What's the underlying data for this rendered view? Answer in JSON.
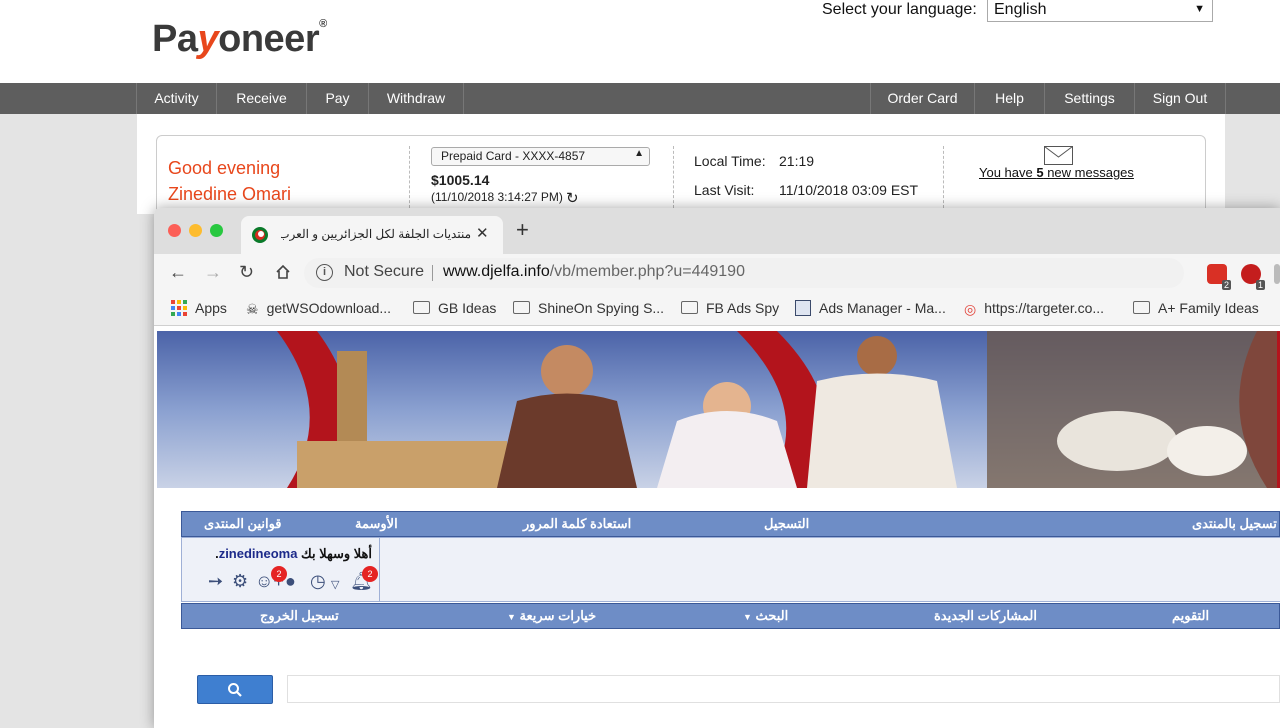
{
  "payoneer": {
    "logo_pre": "Pa",
    "logo_mid": "y",
    "logo_post": "oneer",
    "language_label": "Select your language:",
    "language_value": "English",
    "nav_left": [
      "Activity",
      "Receive",
      "Pay",
      "Withdraw"
    ],
    "nav_right": [
      "Order Card",
      "Help",
      "Settings",
      "Sign Out"
    ],
    "greeting": "Good evening",
    "user_name": "Zinedine Omari",
    "card_select": "Prepaid Card - XXXX-4857",
    "balance": "$1005.14",
    "balance_time": "(11/10/2018 3:14:27 PM)",
    "local_time_label": "Local Time:",
    "local_time_value": "21:19",
    "last_visit_label": "Last Visit:",
    "last_visit_value": "11/10/2018 03:09 EST",
    "messages_prefix": "You have ",
    "messages_count": "5",
    "messages_suffix": " new messages",
    "brand_color": "#e8471c"
  },
  "chrome": {
    "tab_title": "منتديات الجلفة لكل الجزائريين و العرب - ...",
    "not_secure": "Not Secure",
    "url_host": "www.djelfa.info",
    "url_path": "/vb/member.php?u=449190",
    "ext_badges": [
      "2",
      "1"
    ],
    "bookmarks": [
      "Apps",
      "getWSOdownload...",
      "GB Ideas",
      "ShineOn Spying S...",
      "FB Ads Spy",
      "Ads Manager - Ma...",
      "https://targeter.co...",
      "A+ Family Ideas"
    ]
  },
  "forum": {
    "nav_top": [
      "قوانين المنتدى",
      "الأوسمة",
      "استعادة كلمة المرور",
      "التسجيل",
      "تسجيل بالمنتدى"
    ],
    "welcome": "أهلا وسهلا بك ",
    "welcome_user": "zinedineoma",
    "welcome_end": ".",
    "badge_friends": "2",
    "badge_notifications": "2",
    "nav_bottom": [
      "تسجيل الخروج",
      "خيارات سريعة",
      "البحث",
      "المشاركات الجديدة",
      "التقويم"
    ],
    "search_icon": "search-icon"
  }
}
